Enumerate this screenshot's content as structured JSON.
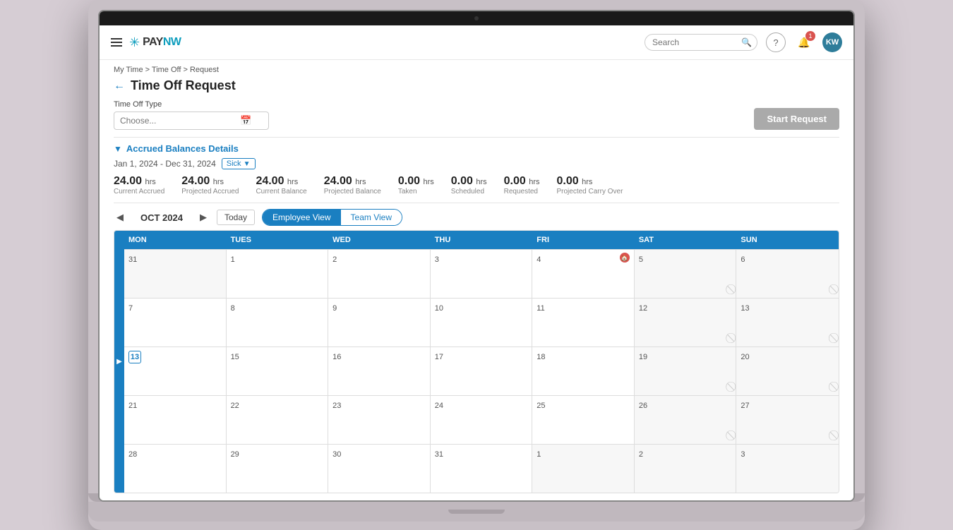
{
  "app": {
    "logo_text": "PAYNW",
    "logo_pay": "PAY",
    "logo_nw": "NW"
  },
  "nav": {
    "search_placeholder": "Search",
    "help_label": "?",
    "notifications_count": "1",
    "avatar_initials": "KW"
  },
  "breadcrumb": {
    "text": "My Time > Time Off > Request"
  },
  "page": {
    "title": "Time Off Request",
    "back_label": "←"
  },
  "time_off_type": {
    "label": "Time Off Type",
    "placeholder": "Choose...",
    "start_request_label": "Start Request"
  },
  "accrued": {
    "title": "Accrued Balances Details",
    "chevron": "▼",
    "date_range": "Jan 1, 2024 - Dec 31, 2024",
    "type": "Sick",
    "stats": [
      {
        "value": "24.00",
        "unit": "hrs",
        "label": "Current Accrued"
      },
      {
        "value": "24.00",
        "unit": "hrs",
        "label": "Projected Accrued"
      },
      {
        "value": "24.00",
        "unit": "hrs",
        "label": "Current Balance"
      },
      {
        "value": "24.00",
        "unit": "hrs",
        "label": "Projected Balance"
      },
      {
        "value": "0.00",
        "unit": "hrs",
        "label": "Taken"
      },
      {
        "value": "0.00",
        "unit": "hrs",
        "label": "Scheduled"
      },
      {
        "value": "0.00",
        "unit": "hrs",
        "label": "Requested"
      },
      {
        "value": "0.00",
        "unit": "hrs",
        "label": "Projected Carry Over"
      }
    ]
  },
  "calendar": {
    "month": "OCT 2024",
    "today_label": "Today",
    "view_employee": "Employee View",
    "view_team": "Team View",
    "headers": [
      "MON",
      "TUES",
      "WED",
      "THU",
      "FRI",
      "SAT",
      "SUN"
    ],
    "weeks": [
      [
        {
          "num": "31",
          "other": true,
          "today": false,
          "sat": false,
          "sun": false,
          "holiday": false,
          "no_icon": false
        },
        {
          "num": "1",
          "other": false,
          "today": false,
          "sat": false,
          "sun": false,
          "holiday": false,
          "no_icon": false
        },
        {
          "num": "2",
          "other": false,
          "today": false,
          "sat": false,
          "sun": false,
          "holiday": false,
          "no_icon": false
        },
        {
          "num": "3",
          "other": false,
          "today": false,
          "sat": false,
          "sun": false,
          "holiday": false,
          "no_icon": false
        },
        {
          "num": "4",
          "other": false,
          "today": false,
          "sat": false,
          "sun": false,
          "holiday": true,
          "no_icon": false
        },
        {
          "num": "5",
          "other": false,
          "today": false,
          "sat": true,
          "sun": false,
          "holiday": false,
          "has_icon": true
        },
        {
          "num": "6",
          "other": false,
          "today": false,
          "sat": false,
          "sun": true,
          "holiday": false,
          "has_icon": true
        }
      ],
      [
        {
          "num": "7",
          "other": false,
          "today": false,
          "sat": false,
          "sun": false,
          "holiday": false,
          "has_icon": false
        },
        {
          "num": "8",
          "other": false,
          "today": false,
          "sat": false,
          "sun": false,
          "holiday": false,
          "has_icon": false
        },
        {
          "num": "9",
          "other": false,
          "today": false,
          "sat": false,
          "sun": false,
          "holiday": false,
          "has_icon": false
        },
        {
          "num": "10",
          "other": false,
          "today": false,
          "sat": false,
          "sun": false,
          "holiday": false,
          "has_icon": false
        },
        {
          "num": "11",
          "other": false,
          "today": false,
          "sat": false,
          "sun": false,
          "holiday": false,
          "has_icon": false
        },
        {
          "num": "12",
          "other": false,
          "today": false,
          "sat": true,
          "sun": false,
          "holiday": false,
          "has_icon": true
        },
        {
          "num": "13",
          "other": false,
          "today": false,
          "sat": false,
          "sun": true,
          "holiday": false,
          "has_icon": true
        }
      ],
      [
        {
          "num": "13",
          "other": false,
          "today": true,
          "sat": false,
          "sun": false,
          "holiday": false,
          "has_icon": false
        },
        {
          "num": "15",
          "other": false,
          "today": false,
          "sat": false,
          "sun": false,
          "holiday": false,
          "has_icon": false
        },
        {
          "num": "16",
          "other": false,
          "today": false,
          "sat": false,
          "sun": false,
          "holiday": false,
          "has_icon": false
        },
        {
          "num": "17",
          "other": false,
          "today": false,
          "sat": false,
          "sun": false,
          "holiday": false,
          "has_icon": false
        },
        {
          "num": "18",
          "other": false,
          "today": false,
          "sat": false,
          "sun": false,
          "holiday": false,
          "has_icon": false
        },
        {
          "num": "19",
          "other": false,
          "today": false,
          "sat": true,
          "sun": false,
          "holiday": false,
          "has_icon": true
        },
        {
          "num": "20",
          "other": false,
          "today": false,
          "sat": false,
          "sun": true,
          "holiday": false,
          "has_icon": true
        }
      ],
      [
        {
          "num": "21",
          "other": false,
          "today": false,
          "sat": false,
          "sun": false,
          "holiday": false,
          "has_icon": false
        },
        {
          "num": "22",
          "other": false,
          "today": false,
          "sat": false,
          "sun": false,
          "holiday": false,
          "has_icon": false
        },
        {
          "num": "23",
          "other": false,
          "today": false,
          "sat": false,
          "sun": false,
          "holiday": false,
          "has_icon": false
        },
        {
          "num": "24",
          "other": false,
          "today": false,
          "sat": false,
          "sun": false,
          "holiday": false,
          "has_icon": false
        },
        {
          "num": "25",
          "other": false,
          "today": false,
          "sat": false,
          "sun": false,
          "holiday": false,
          "has_icon": false
        },
        {
          "num": "26",
          "other": false,
          "today": false,
          "sat": true,
          "sun": false,
          "holiday": false,
          "has_icon": true
        },
        {
          "num": "27",
          "other": false,
          "today": false,
          "sat": false,
          "sun": true,
          "holiday": false,
          "has_icon": true
        }
      ],
      [
        {
          "num": "28",
          "other": false,
          "today": false,
          "sat": false,
          "sun": false,
          "holiday": false,
          "has_icon": false
        },
        {
          "num": "29",
          "other": false,
          "today": false,
          "sat": false,
          "sun": false,
          "holiday": false,
          "has_icon": false
        },
        {
          "num": "30",
          "other": false,
          "today": false,
          "sat": false,
          "sun": false,
          "holiday": false,
          "has_icon": false
        },
        {
          "num": "31",
          "other": false,
          "today": false,
          "sat": false,
          "sun": false,
          "holiday": false,
          "has_icon": false
        },
        {
          "num": "1",
          "other": true,
          "today": false,
          "sat": false,
          "sun": false,
          "holiday": false,
          "has_icon": false
        },
        {
          "num": "2",
          "other": true,
          "today": false,
          "sat": true,
          "sun": false,
          "holiday": false,
          "has_icon": false
        },
        {
          "num": "3",
          "other": true,
          "today": false,
          "sat": false,
          "sun": true,
          "holiday": false,
          "has_icon": false
        }
      ]
    ]
  }
}
